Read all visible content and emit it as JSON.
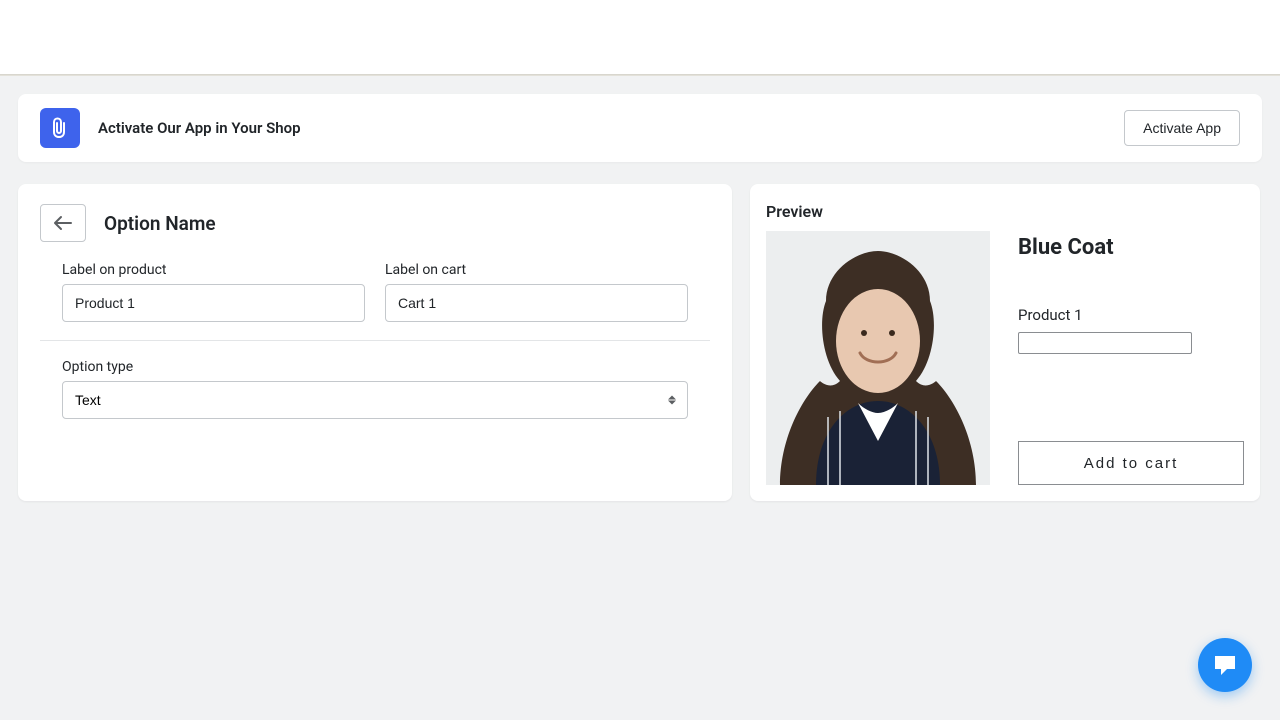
{
  "banner": {
    "title": "Activate Our App in Your Shop",
    "button": "Activate App"
  },
  "editor": {
    "title": "Option Name",
    "label_product_label": "Label on product",
    "label_product_value": "Product 1",
    "label_cart_label": "Label on cart",
    "label_cart_value": "Cart 1",
    "option_type_label": "Option type",
    "option_type_value": "Text"
  },
  "preview": {
    "heading": "Preview",
    "product_title": "Blue Coat",
    "option_label": "Product 1",
    "option_value": "",
    "add_to_cart": "Add to cart"
  }
}
